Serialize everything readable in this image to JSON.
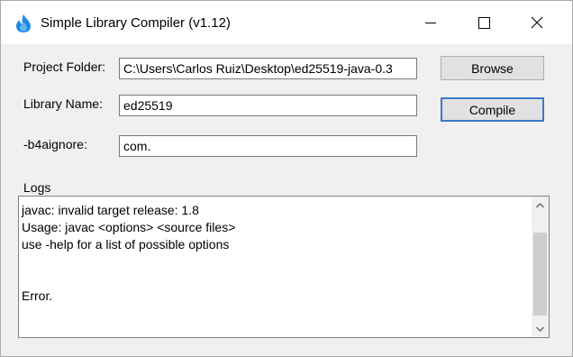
{
  "window": {
    "title": "Simple Library Compiler (v1.12)",
    "accent_color": "#3c78c8"
  },
  "form": {
    "project_folder_label": "Project Folder:",
    "project_folder_value": "C:\\Users\\Carlos Ruiz\\Desktop\\ed25519-java-0.3",
    "library_name_label": "Library Name:",
    "library_name_value": "ed25519",
    "b4aignore_label": "-b4aignore:",
    "b4aignore_value": "com."
  },
  "buttons": {
    "browse": "Browse",
    "compile": "Compile"
  },
  "logs": {
    "label": "Logs",
    "lines": [
      "javac: invalid target release: 1.8",
      "Usage: javac <options> <source files>",
      "use -help for a list of possible options",
      "",
      "",
      "Error."
    ]
  }
}
